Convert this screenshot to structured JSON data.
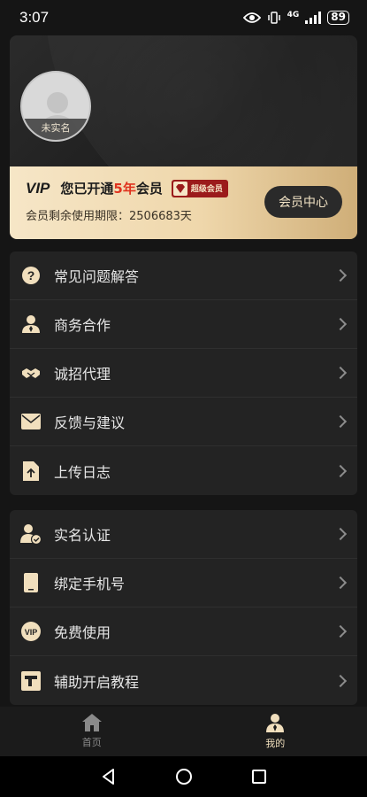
{
  "status_bar": {
    "time": "3:07",
    "network": "4G",
    "battery": "89"
  },
  "profile": {
    "avatar_label": "未实名",
    "vip_logo": "VIP",
    "vip_prefix": "您已开通",
    "vip_years": "5年",
    "vip_suffix": "会员",
    "badge_label": "超级会员",
    "expiry_text": "会员剩余使用期限：2506683天",
    "member_center_label": "会员中心"
  },
  "menu_group_1": [
    {
      "label": "常见问题解答",
      "icon": "question-icon"
    },
    {
      "label": "商务合作",
      "icon": "person-icon"
    },
    {
      "label": "诚招代理",
      "icon": "handshake-icon"
    },
    {
      "label": "反馈与建议",
      "icon": "mail-icon"
    },
    {
      "label": "上传日志",
      "icon": "upload-file-icon"
    }
  ],
  "menu_group_2": [
    {
      "label": "实名认证",
      "icon": "verified-user-icon"
    },
    {
      "label": "绑定手机号",
      "icon": "phone-icon"
    },
    {
      "label": "免费使用",
      "icon": "vip-icon"
    },
    {
      "label": "辅助开启教程",
      "icon": "tutorial-icon"
    }
  ],
  "tabs": [
    {
      "label": "首页",
      "icon": "home-icon",
      "active": false
    },
    {
      "label": "我的",
      "icon": "profile-icon",
      "active": true
    }
  ],
  "colors": {
    "accent_gold": "#f1dfbd",
    "vip_red": "#e0331f",
    "background": "#151515",
    "card": "#232323"
  }
}
